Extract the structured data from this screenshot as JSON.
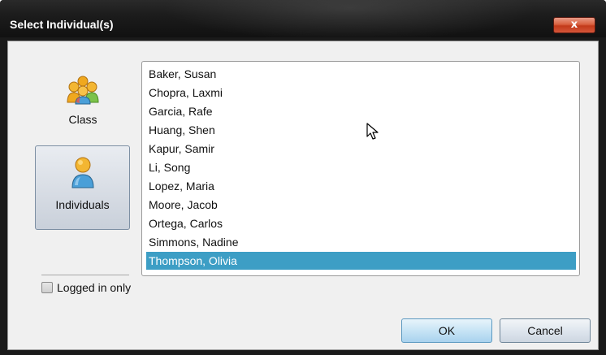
{
  "window": {
    "title": "Select Individual(s)",
    "close_label": "x"
  },
  "modes": {
    "class_label": "Class",
    "individuals_label": "Individuals",
    "selected": "Individuals"
  },
  "filter": {
    "logged_in_only_label": "Logged in only",
    "checked": false
  },
  "list": {
    "items": [
      "Baker, Susan",
      "Chopra, Laxmi",
      "Garcia, Rafe",
      "Huang, Shen",
      "Kapur, Samir",
      "Li, Song",
      "Lopez, Maria",
      "Moore, Jacob",
      "Ortega, Carlos",
      "Simmons, Nadine",
      "Thompson, Olivia"
    ],
    "selected": "Thompson, Olivia"
  },
  "buttons": {
    "ok_label": "OK",
    "cancel_label": "Cancel"
  },
  "colors": {
    "selection": "#3d9ec5",
    "close_button": "#d9603f"
  },
  "icons": {
    "class": "group-of-people-icon",
    "individuals": "single-person-icon",
    "pointer": "mouse-pointer-icon"
  }
}
